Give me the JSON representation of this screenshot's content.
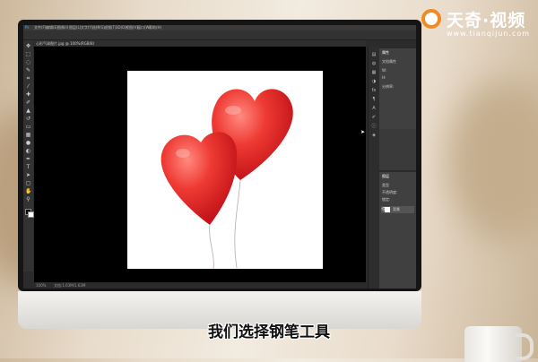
{
  "watermark": {
    "brand": "天奇·视频",
    "url": "www.tianqijun.com",
    "accent": "#f08a24"
  },
  "subtitle": "我们选择钢笔工具",
  "photoshop": {
    "menu": [
      "文件(F)",
      "编辑(E)",
      "图像(I)",
      "图层(L)",
      "文字(Y)",
      "选择(S)",
      "滤镜(T)",
      "3D(D)",
      "视图(V)",
      "窗口(W)",
      "帮助(H)"
    ],
    "tab_label": "心形气球图片.jpg @ 100%(RGB/8)",
    "status_left": "100%",
    "status_doc": "文档:1.63M/1.63M",
    "canvas_color": "#000000",
    "document_bg": "#ffffff",
    "panels": {
      "properties_title": "属性",
      "properties_rows": [
        "文档属性",
        "W:",
        "H:",
        "分辨率:"
      ],
      "layers_title": "图层",
      "layers_rows": [
        "类型",
        "不透明度:",
        "锁定:"
      ],
      "layer_name": "背景"
    }
  },
  "balloon_color": "#e8262b"
}
